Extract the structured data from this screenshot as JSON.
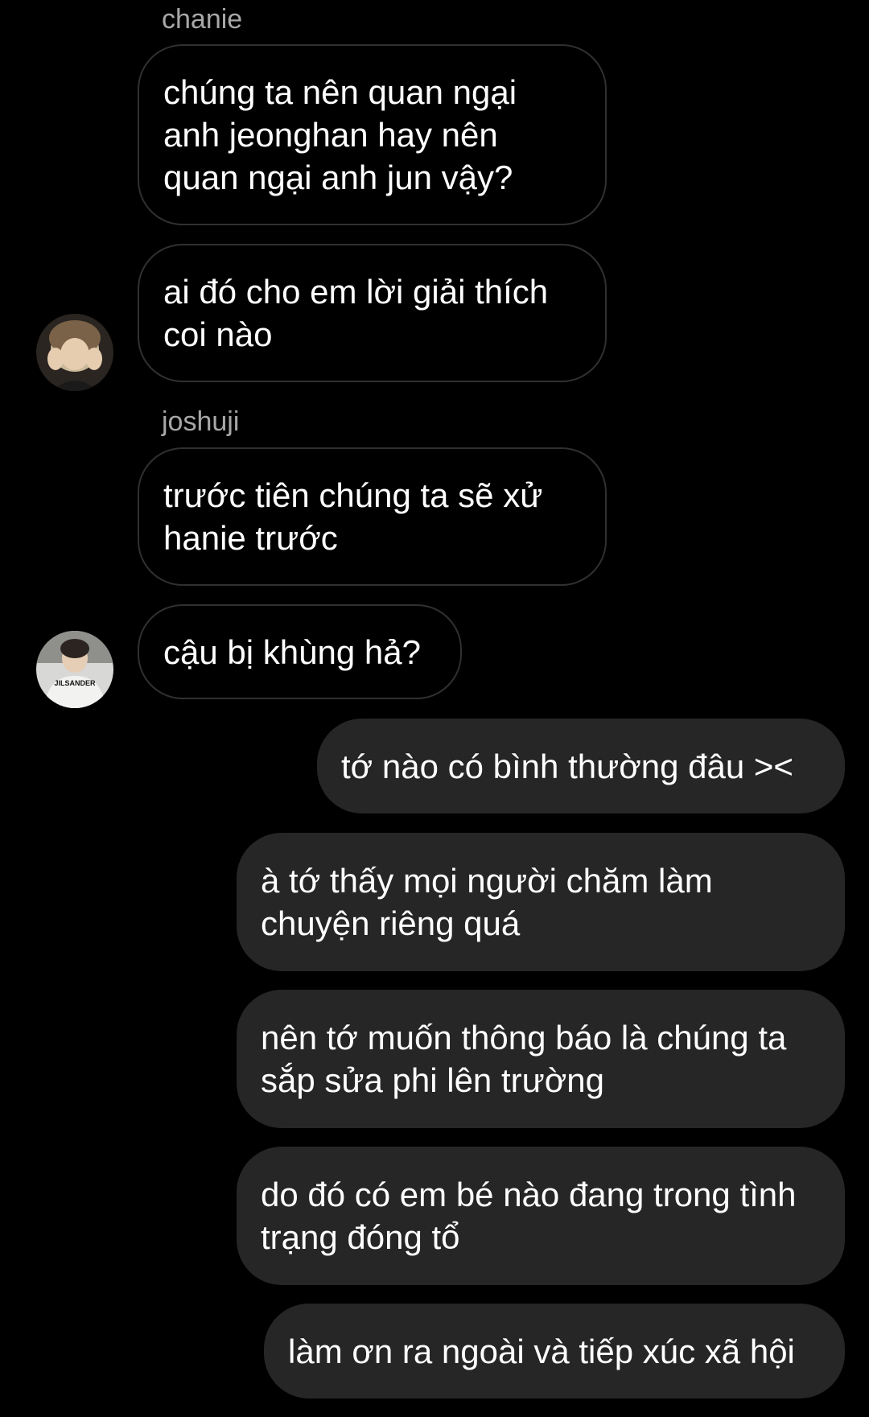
{
  "chat": {
    "groups": [
      {
        "sender": "chanie",
        "messages": [
          "chúng ta nên quan ngại anh jeonghan hay nên quan ngại anh jun vậy?",
          "ai đó cho em lời giải thích coi nào"
        ],
        "avatar_icon": "user-avatar-photo"
      },
      {
        "sender": "joshuji",
        "messages": [
          "trước tiên chúng ta sẽ xử hanie trước",
          "cậu bị khùng hả?"
        ],
        "avatar_icon": "user-avatar-photo",
        "avatar_shirt_text": "JILSANDER"
      }
    ],
    "outgoing": [
      "tớ nào có bình thường đâu ><",
      "à tớ thấy mọi người chăm làm chuyện riêng quá",
      "nên tớ muốn thông báo là chúng ta sắp sửa phi lên trường",
      "do đó có em bé nào đang trong tình trạng đóng tổ",
      "làm ơn ra ngoài và tiếp xúc xã hội"
    ]
  },
  "colors": {
    "background": "#000000",
    "incoming_border": "#303030",
    "outgoing_bubble": "#262626",
    "sender_name": "#a8a8a8",
    "text": "#ffffff"
  }
}
